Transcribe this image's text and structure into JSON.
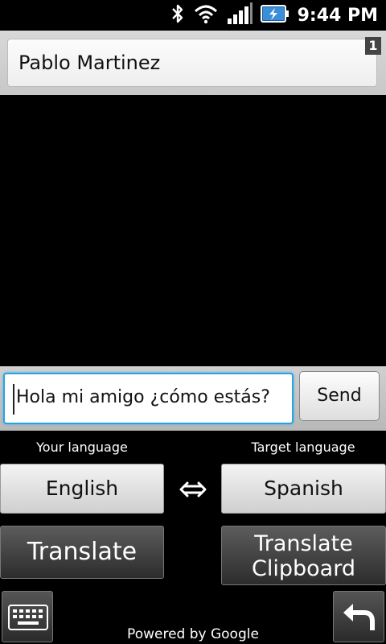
{
  "status_bar": {
    "time": "9:44 PM",
    "icons": [
      "bluetooth-icon",
      "wifi-icon",
      "signal-icon",
      "battery-charging-icon"
    ]
  },
  "recipient": {
    "name": "Pablo Martinez",
    "badge": "1"
  },
  "compose": {
    "message": "Hola mi amigo ¿cómo estás?",
    "send_label": "Send"
  },
  "languages": {
    "your_label": "Your language",
    "target_label": "Target language",
    "your_value": "English",
    "target_value": "Spanish",
    "swap_icon": "swap-arrows-icon"
  },
  "actions": {
    "translate": "Translate",
    "translate_clipboard_line1": "Translate",
    "translate_clipboard_line2": "Clipboard"
  },
  "footer": {
    "powered_by": "Powered by Google",
    "keyboard_icon": "keyboard-icon",
    "back_icon": "undo-icon"
  },
  "colors": {
    "focus_border": "#2aa2e0",
    "header_bg": "#d0d0d0",
    "battery_blue": "#3b8fd8"
  }
}
